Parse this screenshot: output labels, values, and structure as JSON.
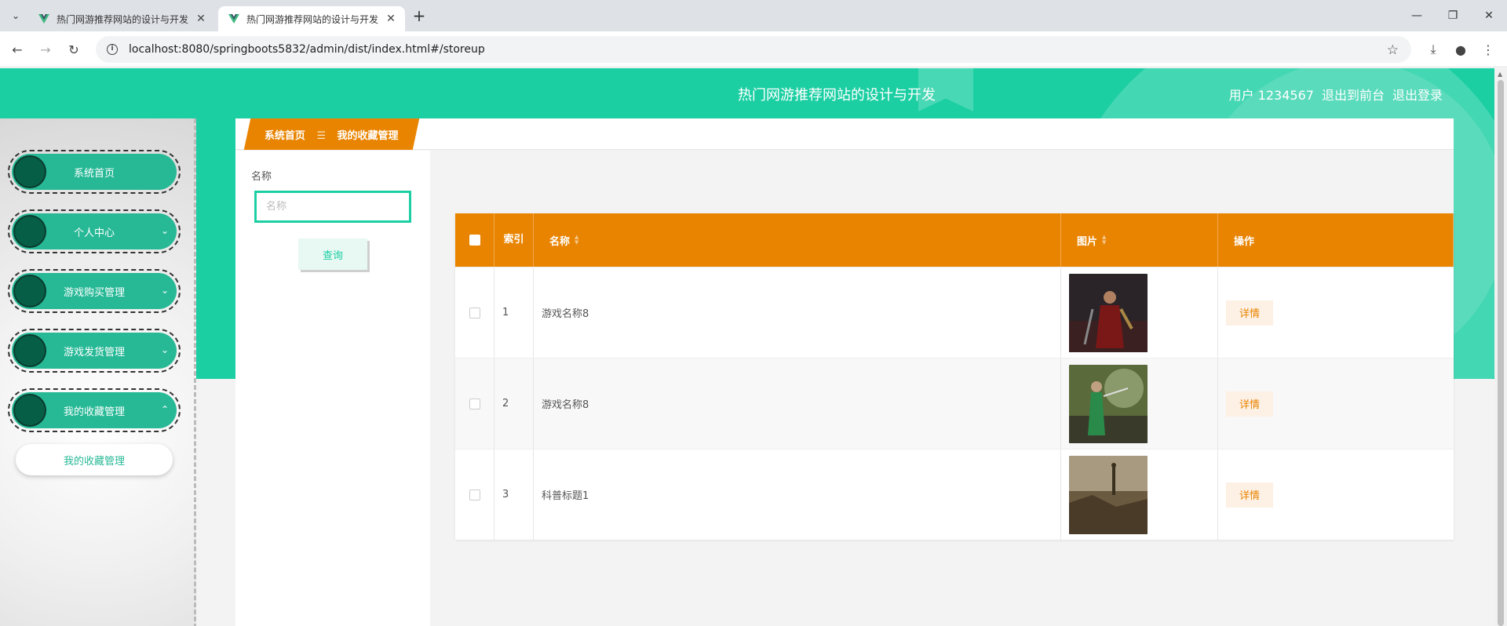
{
  "browser": {
    "tabs": [
      {
        "title": "热门网游推荐网站的设计与开发",
        "active": false
      },
      {
        "title": "热门网游推荐网站的设计与开发",
        "active": true
      }
    ],
    "url": "localhost:8080/springboots5832/admin/dist/index.html#/storeup"
  },
  "header": {
    "site_title": "热门网游推荐网站的设计与开发",
    "user": "用户 1234567",
    "exit_front": "退出到前台",
    "logout": "退出登录"
  },
  "sidebar": {
    "items": [
      {
        "label": "系统首页",
        "has_chevron": false
      },
      {
        "label": "个人中心",
        "chevron": "⌄"
      },
      {
        "label": "游戏购买管理",
        "chevron": "⌄"
      },
      {
        "label": "游戏发货管理",
        "chevron": "⌄"
      },
      {
        "label": "我的收藏管理",
        "chevron": "⌃"
      }
    ],
    "submenu": "我的收藏管理"
  },
  "breadcrumb": {
    "home": "系统首页",
    "separator": "☰",
    "current": "我的收藏管理"
  },
  "search": {
    "label": "名称",
    "placeholder": "名称",
    "button": "查询"
  },
  "table": {
    "columns": {
      "index": "索引",
      "name": "名称",
      "image": "图片",
      "actions": "操作"
    },
    "rows": [
      {
        "index": "1",
        "name": "游戏名称8",
        "image": "dark-armored-warrior",
        "action": "详情"
      },
      {
        "index": "2",
        "name": "游戏名称8",
        "image": "green-archer",
        "action": "详情"
      },
      {
        "index": "3",
        "name": "科普标题1",
        "image": "ancient-city-warrior",
        "action": "详情"
      }
    ]
  },
  "colors": {
    "primary": "#1ccfa3",
    "accent": "#e98400",
    "menu": "#27b996",
    "menu_dot": "#075e46"
  }
}
